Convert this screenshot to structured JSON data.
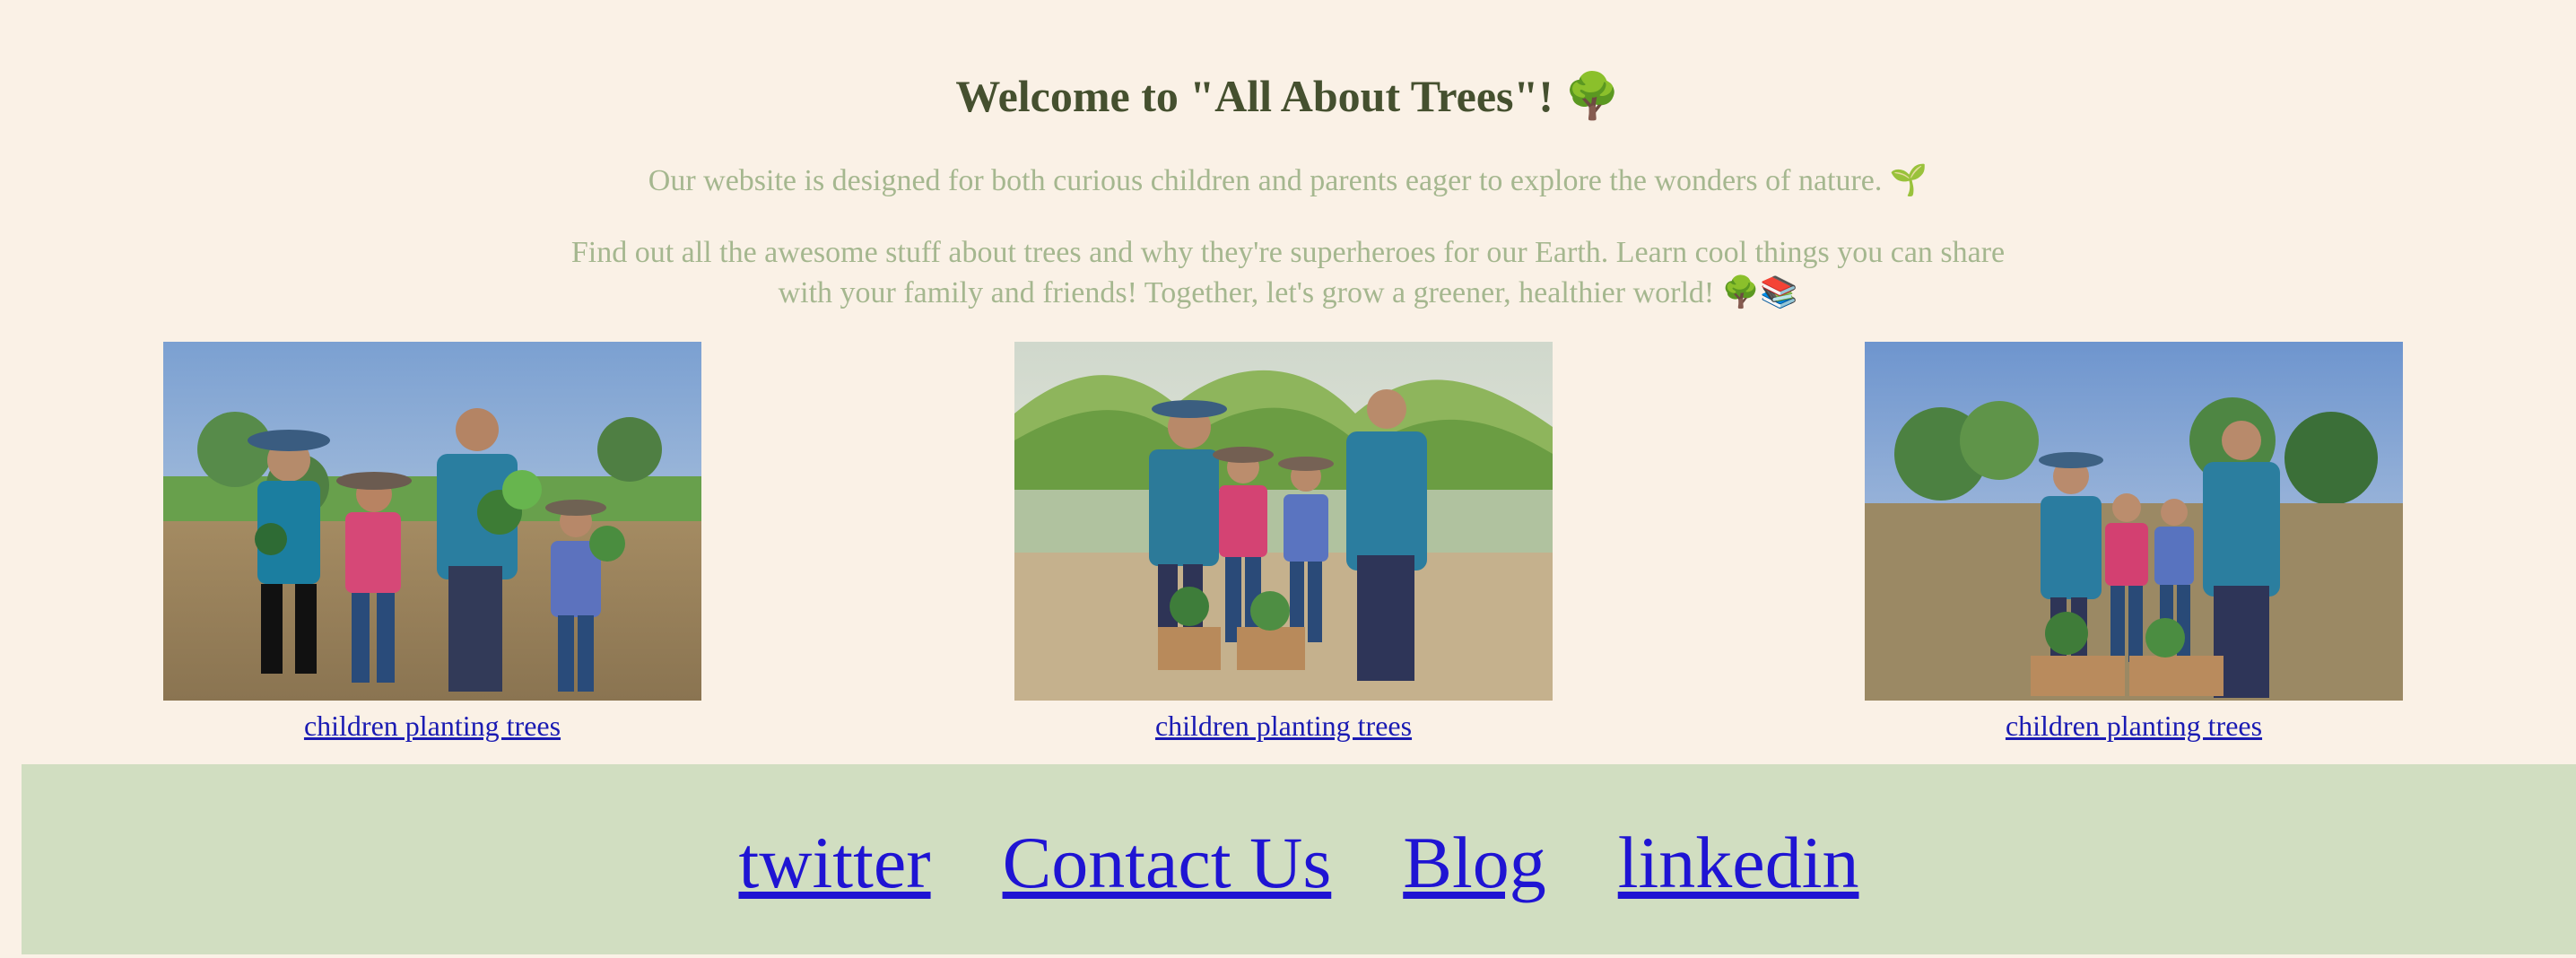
{
  "hero": {
    "title": "Welcome to \"All About Trees\"! 🌳",
    "intro": "Our website is designed for both curious children and parents eager to explore the wonders of nature. 🌱",
    "description": "Find out all the awesome stuff about trees and why they're superheroes for our Earth. Learn cool things you can share with your family and friends! Together, let's grow a greener, healthier world! 🌳📚"
  },
  "gallery": [
    {
      "caption": "children planting trees"
    },
    {
      "caption": "children planting trees"
    },
    {
      "caption": "children planting trees"
    }
  ],
  "footer": {
    "links": [
      "twitter",
      "Contact Us",
      "Blog",
      "linkedin"
    ]
  }
}
